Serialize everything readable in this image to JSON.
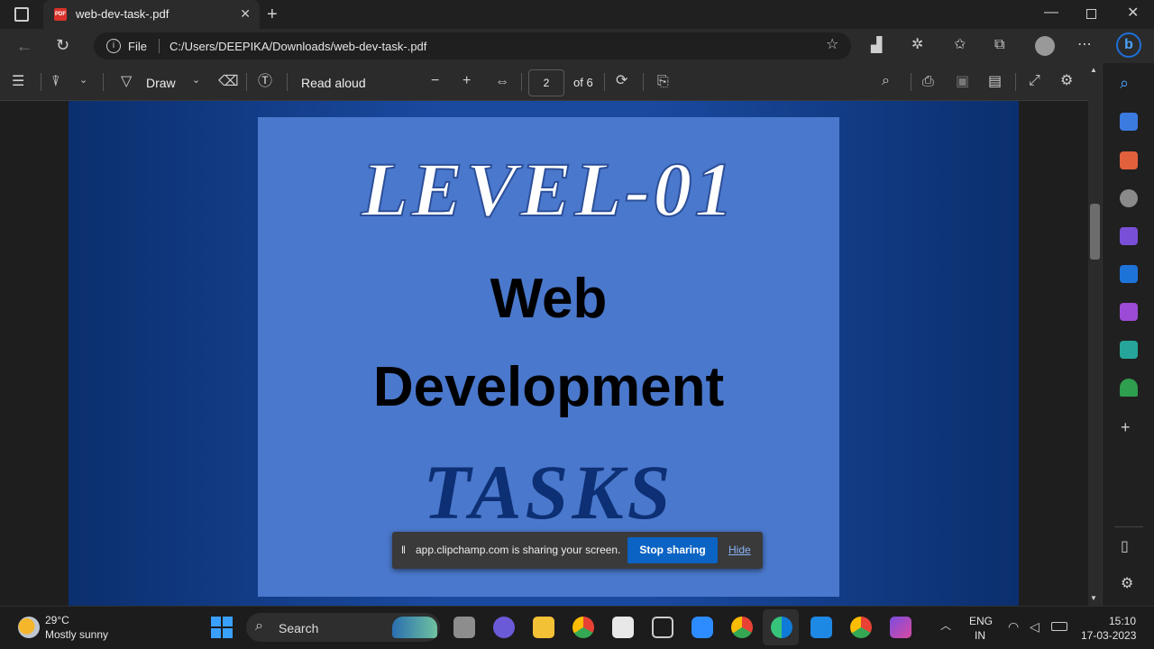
{
  "tab": {
    "title": "web-dev-task-.pdf",
    "favicon": "PDF"
  },
  "address": {
    "label": "File",
    "url": "C:/Users/DEEPIKA/Downloads/web-dev-task-.pdf"
  },
  "pdf_toolbar": {
    "draw_label": "Draw",
    "read_aloud_label": "Read aloud",
    "page_current": "2",
    "page_total": "of 6"
  },
  "slide": {
    "level": "LEVEL-01",
    "line1": "Web",
    "line2": "Development",
    "line3": "TASKS"
  },
  "share_banner": {
    "message": "app.clipchamp.com is sharing your screen.",
    "stop_label": "Stop sharing",
    "hide_label": "Hide"
  },
  "taskbar": {
    "weather_temp": "29°C",
    "weather_desc": "Mostly sunny",
    "search_label": "Search",
    "lang_line1": "ENG",
    "lang_line2": "IN",
    "time": "15:10",
    "date": "17-03-2023"
  },
  "colors": {
    "accent": "#0b63c4",
    "slide_bg": "#1a4aa0",
    "card_bg": "#4a78cc"
  }
}
